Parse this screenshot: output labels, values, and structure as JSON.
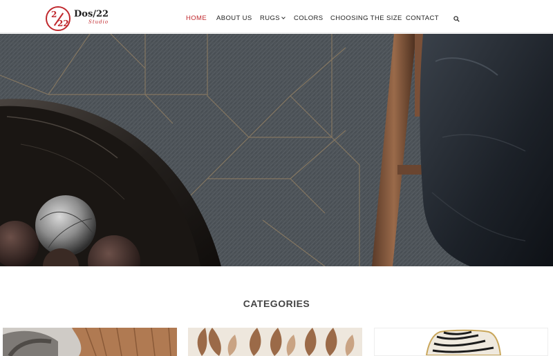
{
  "brand": {
    "logo_top": "2",
    "logo_bottom": "22",
    "name": "Dos/22",
    "tagline": "Studio",
    "accent": "#c0282d"
  },
  "nav": [
    {
      "label": "HOME",
      "active": true
    },
    {
      "label": "ABOUT US",
      "active": false
    },
    {
      "label": "RUGS",
      "active": false,
      "has_dropdown": true
    },
    {
      "label": "COLORS",
      "active": false
    },
    {
      "label": "CHOOSING THE SIZE",
      "active": false
    },
    {
      "label": "CONTACT",
      "active": false
    }
  ],
  "search_icon": "search-icon",
  "hero": {
    "image": "dark grey cowhide rug with wooden bowl, spheres and leather chair"
  },
  "categories": {
    "title": "CATEGORIES",
    "cards": [
      {
        "image": "grey patterned rug with tan fringe throw"
      },
      {
        "image": "cream rug with brown leaf pattern"
      },
      {
        "image": "zebra cowhide rug"
      }
    ]
  }
}
